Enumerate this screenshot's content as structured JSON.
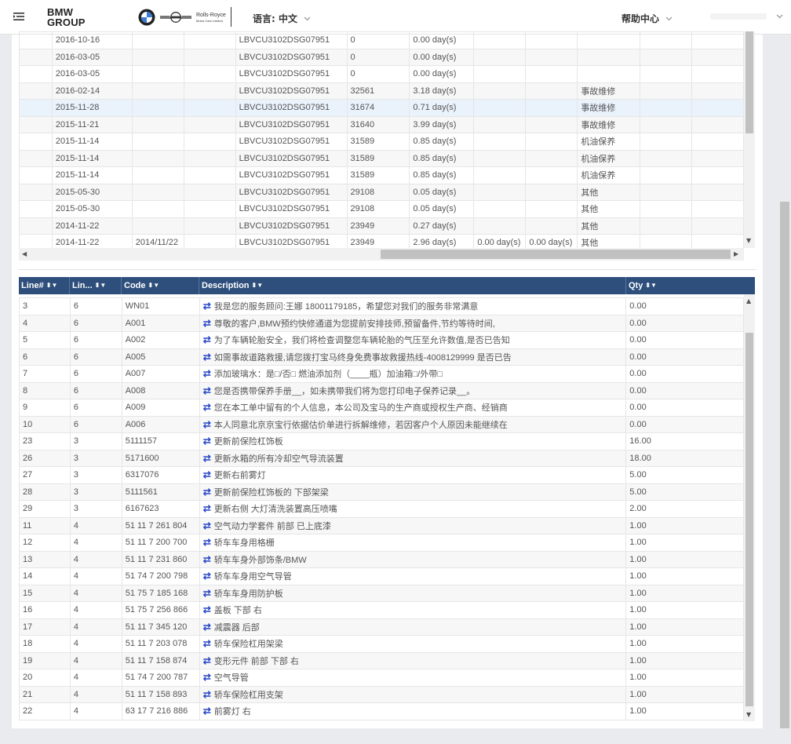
{
  "header": {
    "group_logo_line1": "BMW",
    "group_logo_line2": "GROUP",
    "rr_logo_line1": "Rolls-Royce",
    "rr_logo_line2": "Motor Cars Limited",
    "language_label": "语言: 中文",
    "help_label": "帮助中心"
  },
  "top_grid": {
    "rows": [
      [
        "",
        "2016-10-16",
        "",
        "",
        "LBVCU3102DSG07951",
        "0",
        "0.00 day(s)",
        "",
        "",
        "",
        "",
        ""
      ],
      [
        "",
        "2016-03-05",
        "",
        "",
        "LBVCU3102DSG07951",
        "0",
        "0.00 day(s)",
        "",
        "",
        "",
        "",
        ""
      ],
      [
        "",
        "2016-03-05",
        "",
        "",
        "LBVCU3102DSG07951",
        "0",
        "0.00 day(s)",
        "",
        "",
        "",
        "",
        ""
      ],
      [
        "",
        "2016-02-14",
        "",
        "",
        "LBVCU3102DSG07951",
        "32561",
        "3.18 day(s)",
        "",
        "",
        "事故维修",
        "",
        ""
      ],
      [
        "",
        "2015-11-28",
        "",
        "",
        "LBVCU3102DSG07951",
        "31674",
        "0.71 day(s)",
        "",
        "",
        "事故维修",
        "",
        ""
      ],
      [
        "",
        "2015-11-21",
        "",
        "",
        "LBVCU3102DSG07951",
        "31640",
        "3.99 day(s)",
        "",
        "",
        "事故维修",
        "",
        ""
      ],
      [
        "",
        "2015-11-14",
        "",
        "",
        "LBVCU3102DSG07951",
        "31589",
        "0.85 day(s)",
        "",
        "",
        "机油保养",
        "",
        ""
      ],
      [
        "",
        "2015-11-14",
        "",
        "",
        "LBVCU3102DSG07951",
        "31589",
        "0.85 day(s)",
        "",
        "",
        "机油保养",
        "",
        ""
      ],
      [
        "",
        "2015-11-14",
        "",
        "",
        "LBVCU3102DSG07951",
        "31589",
        "0.85 day(s)",
        "",
        "",
        "机油保养",
        "",
        ""
      ],
      [
        "",
        "2015-05-30",
        "",
        "",
        "LBVCU3102DSG07951",
        "29108",
        "0.05 day(s)",
        "",
        "",
        "其他",
        "",
        ""
      ],
      [
        "",
        "2015-05-30",
        "",
        "",
        "LBVCU3102DSG07951",
        "29108",
        "0.05 day(s)",
        "",
        "",
        "其他",
        "",
        ""
      ],
      [
        "",
        "2014-11-22",
        "",
        "",
        "LBVCU3102DSG07951",
        "23949",
        "0.27 day(s)",
        "",
        "",
        "其他",
        "",
        ""
      ],
      [
        "",
        "2014-11-22",
        "2014/11/22",
        "",
        "LBVCU3102DSG07951",
        "23949",
        "2.96 day(s)",
        "0.00 day(s)",
        "0.00 day(s)",
        "其他",
        "",
        ""
      ]
    ]
  },
  "bottom_grid": {
    "columns": [
      "Line#",
      "Lin...",
      "Code",
      "Description",
      "Qty"
    ],
    "rows": [
      [
        "3",
        "6",
        "WN01",
        "我是您的服务顾问:王娜 18001179185，希望您对我们的服务非常满意",
        "0.00"
      ],
      [
        "4",
        "6",
        "A001",
        "尊敬的客户,BMW预约快修通道为您提前安排技师,预留备件,节约等待时间,",
        "0.00"
      ],
      [
        "5",
        "6",
        "A002",
        "为了车辆轮胎安全，我们将检查调整您车辆轮胎的气压至允许数值,是否已告知",
        "0.00"
      ],
      [
        "6",
        "6",
        "A005",
        "如需事故道路救援,请您拨打宝马终身免费事故救援热线-4008129999 是否已告",
        "0.00"
      ],
      [
        "7",
        "6",
        "A007",
        "添加玻璃水：是□/否□ 燃油添加剂（____瓶）加油箱□/外带□",
        "0.00"
      ],
      [
        "8",
        "6",
        "A008",
        "您是否携带保养手册__，如未携带我们将为您打印电子保养记录__。",
        "0.00"
      ],
      [
        "9",
        "6",
        "A009",
        "您在本工单中留有的个人信息，本公司及宝马的生产商或授权生产商、经销商",
        "0.00"
      ],
      [
        "10",
        "6",
        "A006",
        "本人同意北京京宝行依据估价单进行拆解维修，若因客户个人原因未能继续在",
        "0.00"
      ],
      [
        "23",
        "3",
        "5111157",
        "更新前保险杠饰板",
        "16.00"
      ],
      [
        "26",
        "3",
        "5171600",
        "更新水箱的所有冷却空气导流装置",
        "18.00"
      ],
      [
        "27",
        "3",
        "6317076",
        "更新右前雾灯",
        "5.00"
      ],
      [
        "28",
        "3",
        "5111561",
        "更新前保险杠饰板的 下部架梁",
        "5.00"
      ],
      [
        "29",
        "3",
        "6167623",
        "更新右侧 大灯清洗装置高压喷嘴",
        "2.00"
      ],
      [
        "11",
        "4",
        "51 11 7 261 804",
        "空气动力学套件 前部 已上底漆",
        "1.00"
      ],
      [
        "12",
        "4",
        "51 11 7 200 700",
        "轿车车身用格栅",
        "1.00"
      ],
      [
        "13",
        "4",
        "51 11 7 231 860",
        "轿车车身外部饰条/BMW",
        "1.00"
      ],
      [
        "14",
        "4",
        "51 74 7 200 798",
        "轿车车身用空气导管",
        "1.00"
      ],
      [
        "15",
        "4",
        "51 75 7 185 168",
        "轿车车身用防护板",
        "1.00"
      ],
      [
        "16",
        "4",
        "51 75 7 256 866",
        "盖板 下部 右",
        "1.00"
      ],
      [
        "17",
        "4",
        "51 11 7 345 120",
        "减震器 后部",
        "1.00"
      ],
      [
        "18",
        "4",
        "51 11 7 203 078",
        "轿车保险杠用架梁",
        "1.00"
      ],
      [
        "19",
        "4",
        "51 11 7 158 874",
        "变形元件 前部 下部 右",
        "1.00"
      ],
      [
        "20",
        "4",
        "51 74 7 200 787",
        "空气导管",
        "1.00"
      ],
      [
        "21",
        "4",
        "51 11 7 158 893",
        "轿车保险杠用支架",
        "1.00"
      ],
      [
        "22",
        "4",
        "63 17 7 216 886",
        "前雾灯 右",
        "1.00"
      ]
    ]
  }
}
